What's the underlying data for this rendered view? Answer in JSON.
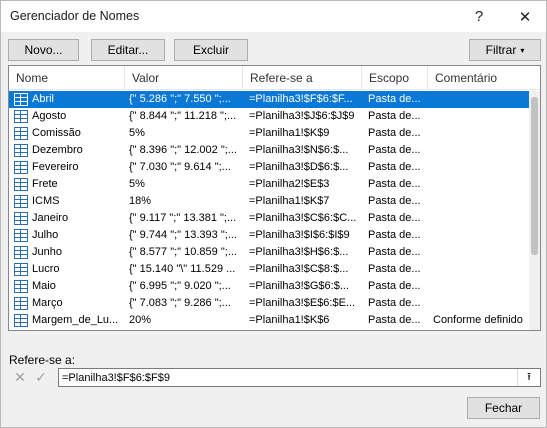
{
  "window": {
    "title": "Gerenciador de Nomes",
    "help": "?",
    "close": "✕"
  },
  "toolbar": {
    "novo": "Novo...",
    "editar": "Editar...",
    "excluir": "Excluir",
    "filtrar": "Filtrar",
    "filtrar_arrow": "▾"
  },
  "columns": [
    "Nome",
    "Valor",
    "Refere-se a",
    "Escopo",
    "Comentário"
  ],
  "rows": [
    {
      "name": "Abril",
      "value": "{\" 5.286 \";\" 7.550 \";...",
      "ref": "=Planilha3!$F$6:$F...",
      "scope": "Pasta de...",
      "comment": "",
      "selected": true
    },
    {
      "name": "Agosto",
      "value": "{\" 8.844 \";\" 11.218 \";...",
      "ref": "=Planilha3!$J$6:$J$9",
      "scope": "Pasta de...",
      "comment": ""
    },
    {
      "name": "Comissão",
      "value": "5%",
      "ref": "=Planilha1!$K$9",
      "scope": "Pasta de...",
      "comment": ""
    },
    {
      "name": "Dezembro",
      "value": "{\" 8.396 \";\" 12.002 \";...",
      "ref": "=Planilha3!$N$6:$...",
      "scope": "Pasta de...",
      "comment": ""
    },
    {
      "name": "Fevereiro",
      "value": "{\" 7.030 \";\" 9.614 \";...",
      "ref": "=Planilha3!$D$6:$...",
      "scope": "Pasta de...",
      "comment": ""
    },
    {
      "name": "Frete",
      "value": "5%",
      "ref": "=Planilha2!$E$3",
      "scope": "Pasta de...",
      "comment": ""
    },
    {
      "name": "ICMS",
      "value": "18%",
      "ref": "=Planilha1!$K$7",
      "scope": "Pasta de...",
      "comment": ""
    },
    {
      "name": "Janeiro",
      "value": "{\" 9.117 \";\" 13.381 \";...",
      "ref": "=Planilha3!$C$6:$C...",
      "scope": "Pasta de...",
      "comment": ""
    },
    {
      "name": "Julho",
      "value": "{\" 9.744 \";\" 13.393 \";...",
      "ref": "=Planilha3!$I$6:$I$9",
      "scope": "Pasta de...",
      "comment": ""
    },
    {
      "name": "Junho",
      "value": "{\" 8.577 \";\" 10.859 \";...",
      "ref": "=Planilha3!$H$6:$...",
      "scope": "Pasta de...",
      "comment": ""
    },
    {
      "name": "Lucro",
      "value": "{\" 15.140 \"\\\" 11.529 ...",
      "ref": "=Planilha3!$C$8:$...",
      "scope": "Pasta de...",
      "comment": ""
    },
    {
      "name": "Maio",
      "value": "{\" 6.995 \";\" 9.020 \";...",
      "ref": "=Planilha3!$G$6:$...",
      "scope": "Pasta de...",
      "comment": ""
    },
    {
      "name": "Março",
      "value": "{\" 7.083 \";\" 9.286 \";...",
      "ref": "=Planilha3!$E$6:$E...",
      "scope": "Pasta de...",
      "comment": ""
    },
    {
      "name": "Margem_de_Lu...",
      "value": "20%",
      "ref": "=Planilha1!$K$6",
      "scope": "Pasta de...",
      "comment": "Conforme definido"
    }
  ],
  "refers_to": {
    "label": "Refere-se a:",
    "value": "=Planilha3!$F$6:$F$9",
    "cancel_icon": "✕",
    "ok_icon": "✓",
    "collapse_icon": "⭱"
  },
  "footer": {
    "fechar": "Fechar"
  }
}
